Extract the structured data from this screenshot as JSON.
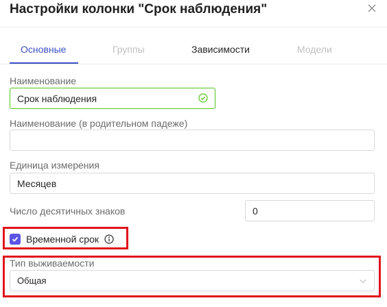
{
  "dialog": {
    "title": "Настройки колонки \"Срок наблюдения\""
  },
  "tabs": [
    {
      "label": "Основные",
      "state": "active"
    },
    {
      "label": "Группы",
      "state": "disabled"
    },
    {
      "label": "Зависимости",
      "state": "normal"
    },
    {
      "label": "Модели",
      "state": "disabled"
    }
  ],
  "form": {
    "name": {
      "label": "Наименование",
      "value": "Срок наблюдения",
      "valid": true
    },
    "name_genitive": {
      "label": "Наименование (в родительном падеже)",
      "value": ""
    },
    "unit": {
      "label": "Единица измерения",
      "value": "Месяцев"
    },
    "decimals": {
      "label": "Число десятичных знаков",
      "value": "0"
    },
    "temporal": {
      "label": "Временной срок",
      "checked": true
    },
    "survival_type": {
      "label": "Тип выживаемости",
      "value": "Общая"
    }
  },
  "colors": {
    "accent": "#3b51c4",
    "checkbox": "#5b54e6",
    "valid": "#52c41a",
    "highlight": "#e0141a"
  },
  "icons": {
    "close": "close-icon",
    "valid": "check-circle-icon",
    "checkbox": "checkmark-icon",
    "info": "info-circle-icon",
    "dropdown": "chevron-down-icon"
  }
}
